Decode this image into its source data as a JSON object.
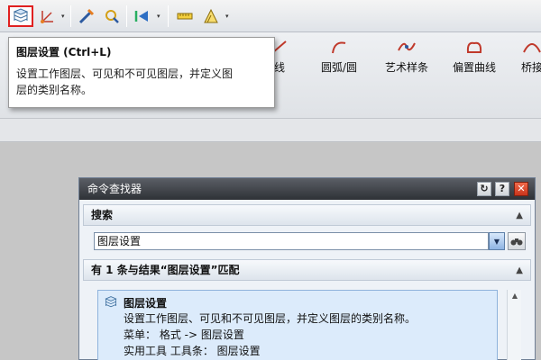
{
  "toolbar": {
    "buttons": [
      {
        "icon": "layer-settings-icon"
      },
      {
        "icon": "wcs-orient-icon"
      },
      {
        "icon": "snap-point-icon"
      },
      {
        "icon": "selection-icon"
      },
      {
        "icon": "view-triad-icon"
      },
      {
        "icon": "measure-ruler-icon"
      }
    ],
    "dropdown_glyph": "▾",
    "selected_color": "#e02020"
  },
  "ribbon": {
    "items": [
      {
        "label": "线"
      },
      {
        "label": "圆弧/圆"
      },
      {
        "label": "艺术样条"
      },
      {
        "label": "偏置曲线"
      },
      {
        "label": "桥接"
      }
    ]
  },
  "tooltip": {
    "title": "图层设置 (Ctrl+L)",
    "body_line1": "设置工作图层、可见和不可见图层，并定义图",
    "body_line2": "层的类别名称。"
  },
  "dialog": {
    "title": "命令查找器",
    "controls": {
      "reset": "↻",
      "help": "?",
      "close": "✕"
    },
    "search_section": "搜索",
    "search_value": "图层设置",
    "drop_glyph": "▼",
    "collapse_glyph": "▲",
    "results_header": "有 1 条与结果“图层设置”匹配",
    "result": {
      "title": "图层设置",
      "desc": "设置工作图层、可见和不可见图层，并定义图层的类别名称。",
      "menu": "菜单： 格式 -> 图层设置",
      "toolbar": "实用工具 工具条： 图层设置"
    }
  },
  "colors": {
    "title_bar": "#3a3d42",
    "close_button": "#d9452a",
    "result_bg": "#dcebfb",
    "accent_blue": "#2b6cc4"
  }
}
